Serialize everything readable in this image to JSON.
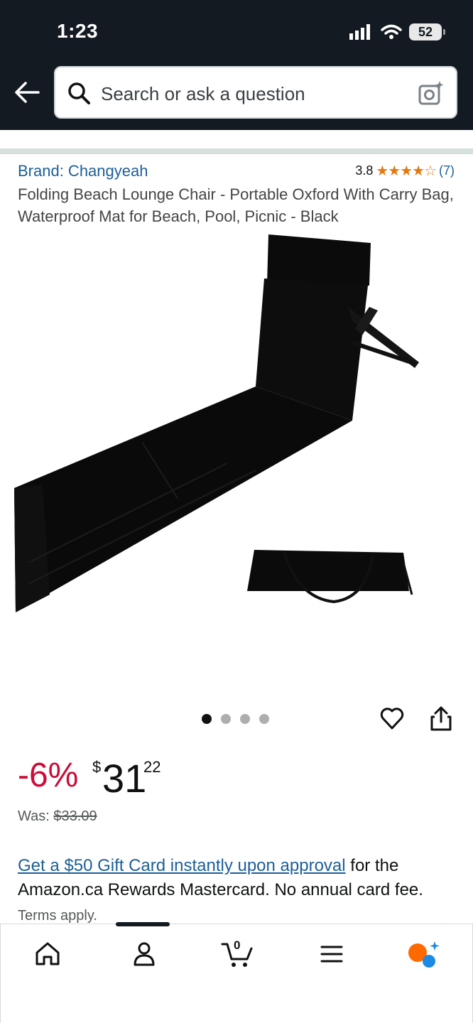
{
  "status_bar": {
    "time": "1:23",
    "battery": "52"
  },
  "search": {
    "placeholder": "Search or ask a question"
  },
  "product": {
    "brand": "Brand: Changyeah",
    "rating_value": "3.8",
    "stars": "★★★★☆",
    "rating_count": "(7)",
    "title": "Folding Beach Lounge Chair - Portable Oxford With Carry Bag, Waterproof Mat for Beach, Pool, Picnic - Black",
    "image_dots_total": 4,
    "image_dot_active": 1
  },
  "pricing": {
    "discount": "-6%",
    "currency_symbol": "$",
    "price_whole": "31",
    "price_fraction": "22",
    "was_label": "Was:",
    "was_price": "$33.09"
  },
  "promo": {
    "link_text": "Get a $50 Gift Card instantly upon approval",
    "text": " for the Amazon.ca Rewards Mastercard. No annual card fee.",
    "terms": " Terms apply."
  },
  "bottom_nav": {
    "cart_count": "0"
  },
  "colors": {
    "header_bg": "#131a22",
    "link": "#1d5f97",
    "discount": "#cc0c39",
    "stars": "#e47911"
  }
}
